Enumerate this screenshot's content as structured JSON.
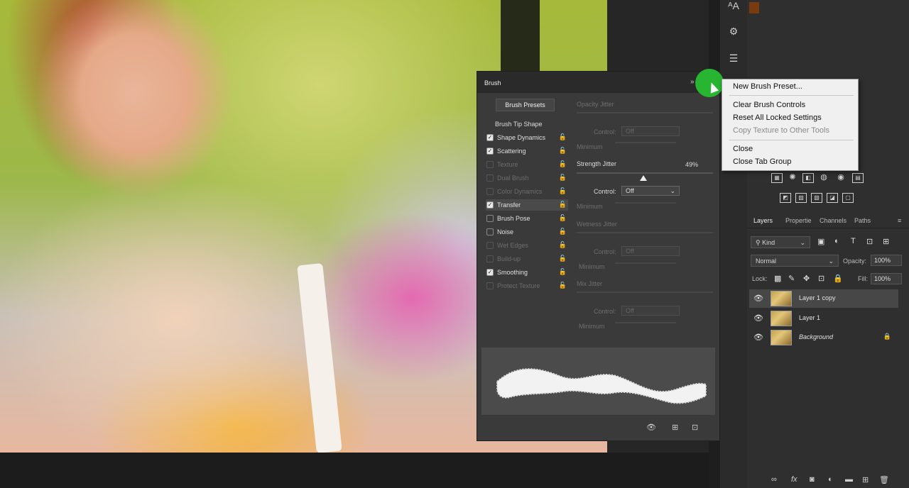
{
  "brush_panel": {
    "title": "Brush",
    "presets_button": "Brush Presets",
    "tip_shape": "Brush Tip Shape",
    "options": [
      {
        "label": "Shape Dynamics",
        "checked": true,
        "enabled": true
      },
      {
        "label": "Scattering",
        "checked": true,
        "enabled": true
      },
      {
        "label": "Texture",
        "checked": false,
        "enabled": false
      },
      {
        "label": "Dual Brush",
        "checked": false,
        "enabled": false
      },
      {
        "label": "Color Dynamics",
        "checked": false,
        "enabled": false
      },
      {
        "label": "Transfer",
        "checked": true,
        "enabled": true,
        "selected": true
      },
      {
        "label": "Brush Pose",
        "checked": false,
        "enabled": true
      },
      {
        "label": "Noise",
        "checked": false,
        "enabled": true
      },
      {
        "label": "Wet Edges",
        "checked": false,
        "enabled": false
      },
      {
        "label": "Build-up",
        "checked": false,
        "enabled": false
      },
      {
        "label": "Smoothing",
        "checked": true,
        "enabled": true
      },
      {
        "label": "Protect Texture",
        "checked": false,
        "enabled": false
      }
    ],
    "transfer": {
      "opacity_jitter": "Opacity Jitter",
      "control": "Control:",
      "off": "Off",
      "minimum": "Minimum",
      "strength_jitter": "Strength Jitter",
      "strength_value": "49%",
      "strength_fraction": 0.49,
      "wetness_jitter": "Wetness Jitter",
      "mix_jitter": "Mix Jitter"
    }
  },
  "context_menu": {
    "items": [
      {
        "label": "New Brush Preset...",
        "enabled": true
      },
      {
        "label": "Clear Brush Controls",
        "enabled": true
      },
      {
        "label": "Reset All Locked Settings",
        "enabled": true
      },
      {
        "label": "Copy Texture to Other Tools",
        "enabled": false
      },
      {
        "label": "Close",
        "enabled": true
      },
      {
        "label": "Close Tab Group",
        "enabled": true
      }
    ]
  },
  "layers_panel": {
    "tabs": [
      "Layers",
      "Properties",
      "Channels",
      "Paths"
    ],
    "tab_labels_shown": [
      "Layers",
      "Propertie",
      "Channels",
      "Paths"
    ],
    "kind": "Kind",
    "blend_mode": "Normal",
    "opacity_label": "Opacity:",
    "opacity_value": "100%",
    "lock_label": "Lock:",
    "fill_label": "Fill:",
    "fill_value": "100%",
    "layers": [
      {
        "name": "Layer 1 copy",
        "selected": true,
        "locked": false
      },
      {
        "name": "Layer 1",
        "selected": false,
        "locked": false
      },
      {
        "name": "Background",
        "selected": false,
        "locked": true
      }
    ]
  },
  "colors": {
    "accent_green": "#28b531",
    "panel_bg": "#3a3a3a",
    "menu_bg": "#f0f0f0"
  }
}
